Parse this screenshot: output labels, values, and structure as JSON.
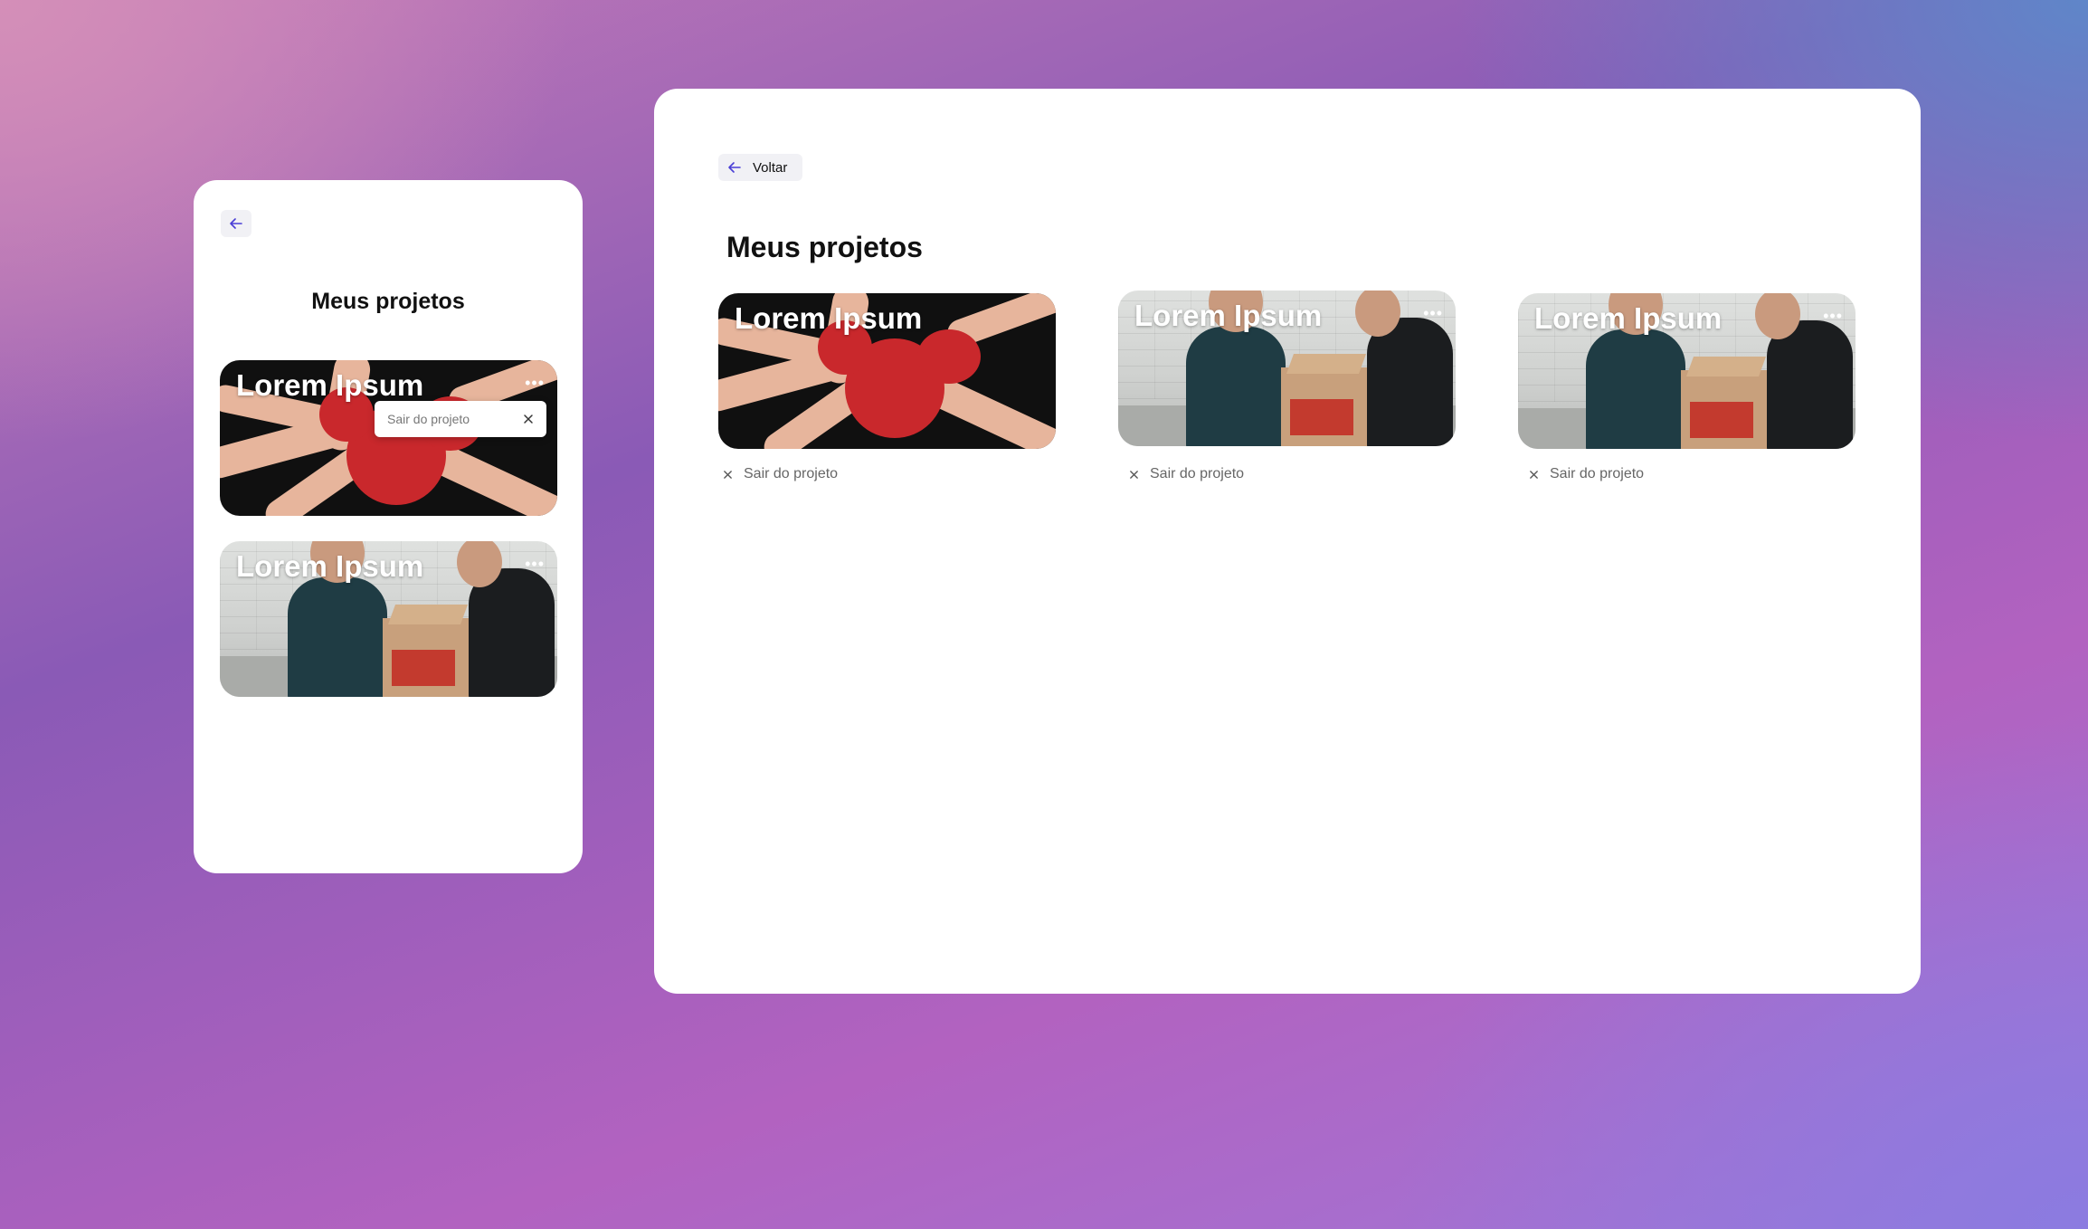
{
  "mobile": {
    "title": "Meus projetos",
    "projects": [
      {
        "name": "Lorem Ipsum",
        "image": "painted-hands"
      },
      {
        "name": "Lorem Ipsum",
        "image": "people-with-boxes"
      }
    ],
    "popup": {
      "label": "Sair do projeto"
    }
  },
  "desktop": {
    "back_label": "Voltar",
    "title": "Meus projetos",
    "projects": [
      {
        "name": "Lorem Ipsum",
        "image": "painted-hands",
        "leave_label": "Sair do projeto"
      },
      {
        "name": "Lorem Ipsum",
        "image": "people-with-boxes",
        "leave_label": "Sair do projeto"
      },
      {
        "name": "Lorem Ipsum",
        "image": "people-with-boxes",
        "leave_label": "Sair do projeto"
      }
    ]
  },
  "icons": {
    "back": "arrow-left-icon",
    "more": "ellipsis-icon",
    "close": "close-icon"
  },
  "colors": {
    "accent": "#4a3fd6",
    "card_bg": "#ffffff",
    "button_bg": "#f1f1f5"
  }
}
